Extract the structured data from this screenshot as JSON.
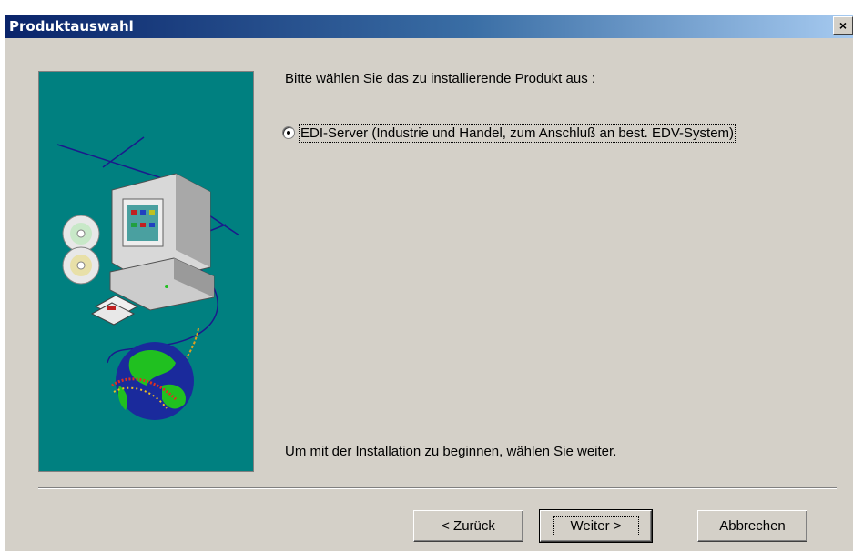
{
  "window": {
    "title": "Produktauswahl",
    "close_label": "×"
  },
  "main": {
    "prompt": "Bitte wählen Sie das zu installierende Produkt aus :",
    "option_label": "EDI-Server (Industrie und Handel, zum Anschluß an best. EDV-System)",
    "option_selected": true,
    "hint": "Um mit der Installation zu beginnen, wählen Sie weiter."
  },
  "buttons": {
    "back": "< Zurück",
    "next": "Weiter >",
    "cancel": "Abbrechen"
  },
  "colors": {
    "titlebar_start": "#0a246a",
    "titlebar_end": "#a6caf0",
    "panel": "#008080",
    "face": "#d4d0c8"
  }
}
